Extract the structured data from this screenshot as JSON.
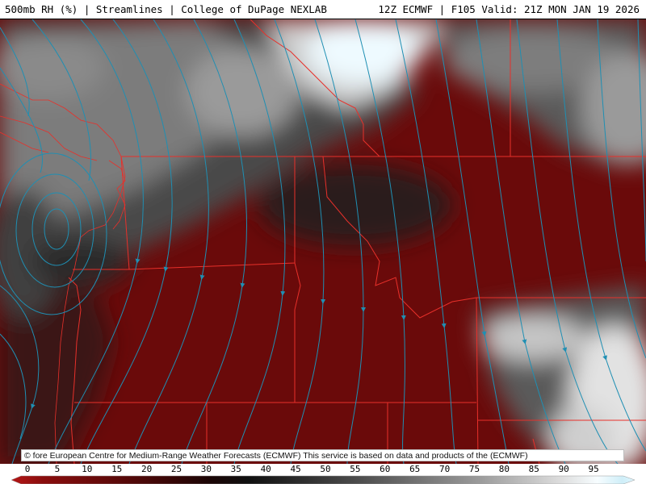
{
  "header": {
    "left_title": "500mb RH (%) | Streamlines | College of DuPage NEXLAB",
    "right_title": "12Z ECMWF | F105 Valid: 21Z MON JAN 19 2026"
  },
  "attribution": "© fore European Centre for Medium-Range Weather Forecasts (ECMWF)  This service is based on data and products of the (ECMWF)",
  "legend": {
    "ticks": [
      "0",
      "5",
      "10",
      "15",
      "20",
      "25",
      "30",
      "35",
      "40",
      "45",
      "50",
      "55",
      "60",
      "65",
      "70",
      "75",
      "80",
      "85",
      "90",
      "95"
    ]
  },
  "colors": {
    "dry": "#7a0b0b",
    "moist_gray": "#6e6e6e",
    "saturated": "#e9f9ff",
    "streamline": "#1f8fb3",
    "border": "#e8302a",
    "header_bg": "#ffffff"
  }
}
